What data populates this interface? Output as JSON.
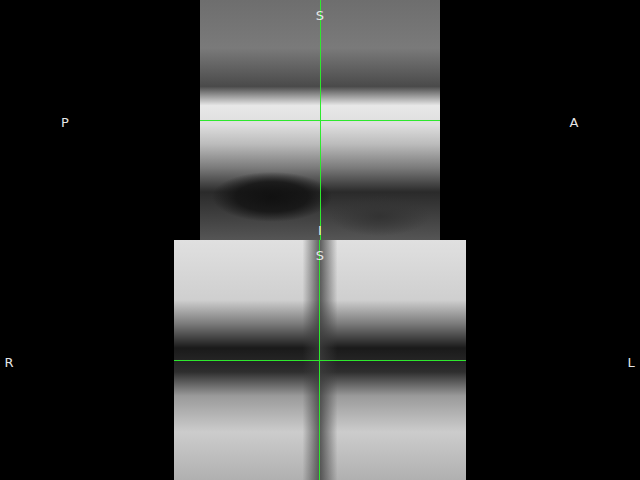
{
  "views": [
    {
      "name": "sagittal",
      "labels": {
        "top": "S",
        "bottom": "I",
        "left": "P",
        "right": "A"
      },
      "crosshair": {
        "x": 0.5,
        "y": 0.5
      }
    },
    {
      "name": "coronal",
      "labels": {
        "top": "S",
        "left": "R",
        "right": "L"
      },
      "crosshair": {
        "x": 0.497,
        "y": 0.5
      }
    }
  ]
}
